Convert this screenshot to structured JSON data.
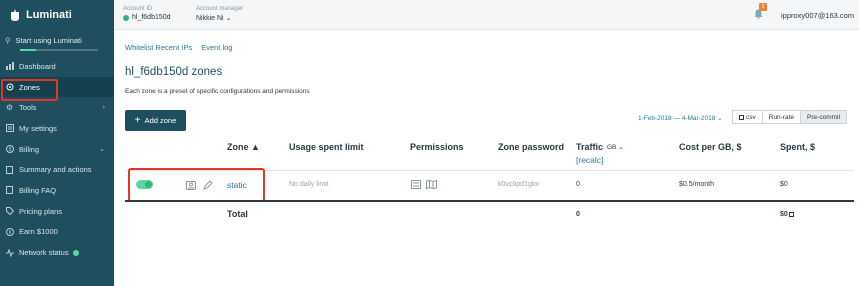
{
  "app": {
    "name": "Luminati"
  },
  "colors": {
    "sidebar": "#1f4e5f",
    "accent": "#2a7a9b",
    "success": "#2fb57c",
    "highlight": "#e0372b",
    "badge": "#f0833a"
  },
  "sidebar": {
    "start_label": "Start using Luminati",
    "items": [
      {
        "label": "Dashboard",
        "icon": "bar-chart-icon"
      },
      {
        "label": "Zones",
        "icon": "zones-icon",
        "active": true
      },
      {
        "label": "Tools",
        "icon": "gear-icon"
      },
      {
        "label": "My settings",
        "icon": "settings-icon"
      },
      {
        "label": "Billing",
        "icon": "dollar-icon"
      },
      {
        "label": "Summary and actions",
        "icon": "document-icon"
      },
      {
        "label": "Billing FAQ",
        "icon": "document-icon"
      },
      {
        "label": "Pricing plans",
        "icon": "tag-icon"
      },
      {
        "label": "Earn $1000",
        "icon": "earn-icon"
      },
      {
        "label": "Network status",
        "icon": "pulse-icon"
      }
    ]
  },
  "header": {
    "account_id_label": "Account ID",
    "account_id": "hl_f6db150d",
    "manager_label": "Account manager",
    "manager": "Nikkie Ni",
    "notification_count": "1",
    "email": "ipproxy007@163.com"
  },
  "links": {
    "whitelist": "Whitelist Recent IPs",
    "event_log": "Event log"
  },
  "page": {
    "title": "hl_f6db150d zones",
    "description": "Each zone is a preset of specific configurations and permissions",
    "add_zone": "Add zone"
  },
  "controls": {
    "date_range": "1-Feb-2018 — 4-Mar-2018",
    "csv": "csv",
    "run_rate": "Run-rate",
    "pre_commit": "Pre-commit"
  },
  "table": {
    "headers": {
      "zone": "Zone",
      "usage": "Usage spent limit",
      "permissions": "Permissions",
      "password": "Zone password",
      "traffic": "Traffic",
      "traffic_unit": "GB",
      "recalc": "[recalc]",
      "cost": "Cost per GB, $",
      "spent": "Spent, $"
    },
    "rows": [
      {
        "zone": "static",
        "usage": "No daily limit",
        "password": "k0vc6pd1glor",
        "traffic": "0",
        "cost": "$0.5/month",
        "spent": "$0"
      }
    ],
    "total": {
      "label": "Total",
      "traffic": "0",
      "spent": "$0"
    }
  }
}
